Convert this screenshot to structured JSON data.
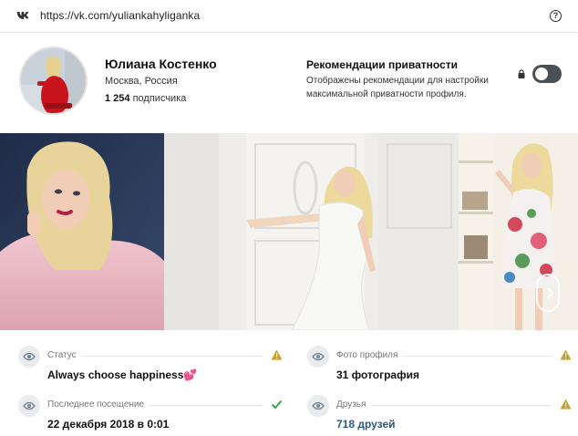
{
  "urlbar": {
    "url": "https://vk.com/yuliankahyliganka",
    "logo_icon": "vk-logo-icon",
    "help_icon": "question-circle-icon"
  },
  "profile": {
    "name": "Юлиана Костенко",
    "location": "Москва, Россия",
    "followers_count": "1 254",
    "followers_label": "подписчика"
  },
  "privacy": {
    "title": "Рекомендации приватности",
    "description": "Отображены рекомендации для настройки максимальной приватности профиля.",
    "lock_icon": "lock-icon",
    "toggle_on": false
  },
  "photos": {
    "count_visible": 3,
    "next_icon": "chevron-right-icon"
  },
  "info": {
    "status": {
      "label": "Статус",
      "value": "Always choose happiness💕",
      "indicator": "warning"
    },
    "profile_photos": {
      "label": "Фото профиля",
      "value": "31 фотография",
      "indicator": "warning"
    },
    "last_seen": {
      "label": "Последнее посещение",
      "value": "22 декабря 2018 в 0:01",
      "indicator": "ok"
    },
    "friends": {
      "label": "Друзья",
      "value": "718 друзей",
      "indicator": "warning"
    }
  },
  "colors": {
    "warning": "#c9a227",
    "ok": "#2fa84f",
    "link": "#2a5885",
    "toggle_off": "#4a4f55"
  }
}
